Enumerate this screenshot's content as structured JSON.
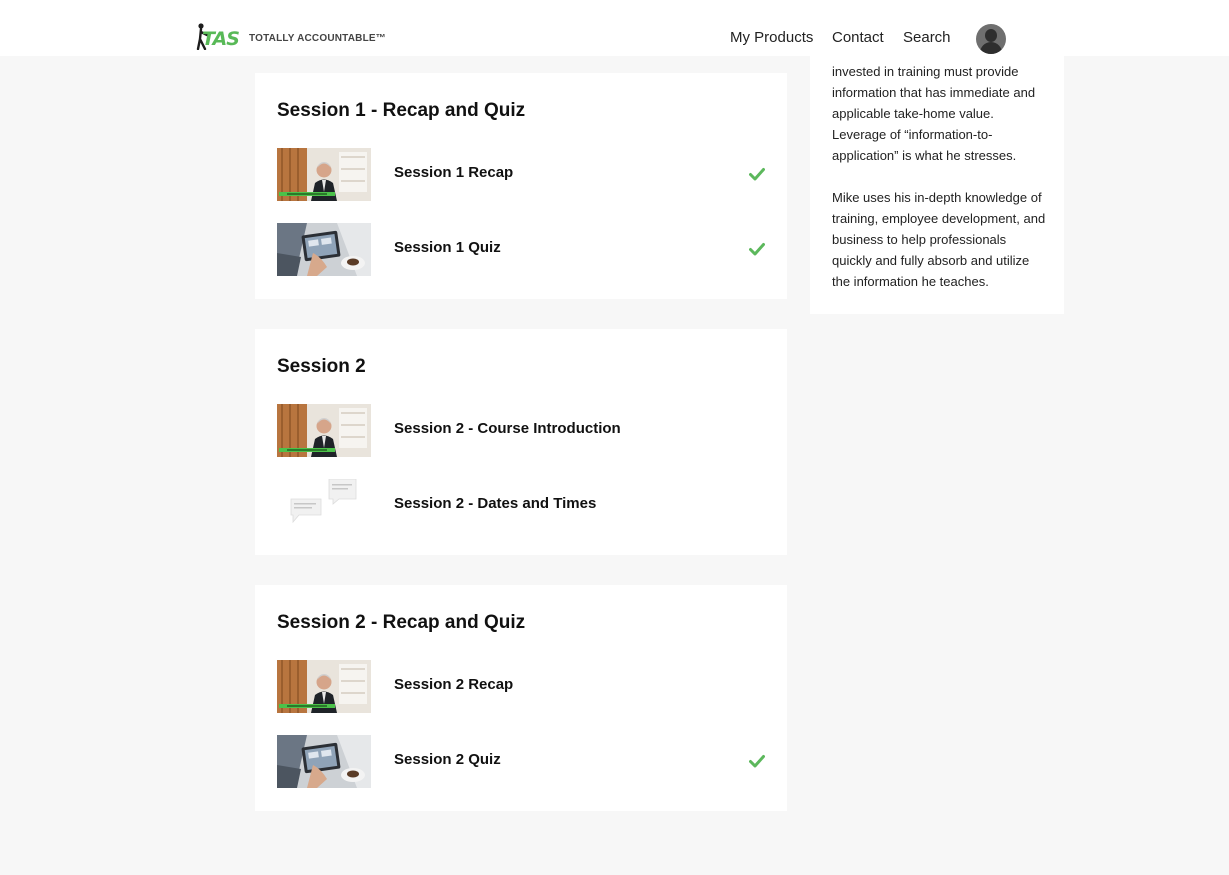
{
  "header": {
    "logo_text": "TOTALLY ACCOUNTABLE™",
    "logo_mark": "TAS",
    "nav": {
      "products": "My Products",
      "contact": "Contact",
      "search": "Search"
    }
  },
  "sidebar": {
    "paragraph1": "invested in training must provide information that has immediate and applicable take-home value. Leverage of “information-to-application” is what he stresses.",
    "paragraph2": "Mike uses his in-depth knowledge of training, employee development, and business to help professionals quickly and fully absorb and utilize the information he teaches."
  },
  "sections": [
    {
      "title": "Session 1 - Recap and Quiz",
      "lessons": [
        {
          "title": "Session 1 Recap",
          "thumb": "presenter-video-thumbnail",
          "completed": true
        },
        {
          "title": "Session 1 Quiz",
          "thumb": "tablet-quiz-thumbnail",
          "completed": true
        }
      ]
    },
    {
      "title": "Session 2",
      "lessons": [
        {
          "title": "Session 2 - Course Introduction",
          "thumb": "presenter-video-thumbnail",
          "completed": false
        },
        {
          "title": "Session 2 - Dates and Times",
          "thumb": "speech-bubbles-thumbnail",
          "completed": false
        }
      ]
    },
    {
      "title": "Session 2 - Recap and Quiz",
      "lessons": [
        {
          "title": "Session 2 Recap",
          "thumb": "presenter-video-thumbnail",
          "completed": false
        },
        {
          "title": "Session 2 Quiz",
          "thumb": "tablet-quiz-thumbnail",
          "completed": true
        }
      ]
    }
  ],
  "colors": {
    "check": "#5cb85c",
    "brand_green": "#58b957"
  }
}
